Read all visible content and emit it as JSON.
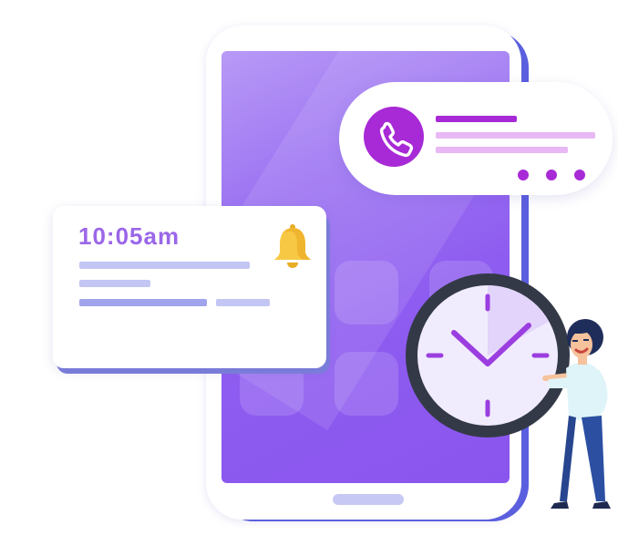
{
  "notification": {
    "time": "10:05am",
    "icon": "bell-icon",
    "accent_color": "#9b67e8"
  },
  "call_card": {
    "icon": "phone-icon",
    "accent_color": "#a72ad6"
  },
  "clock": {
    "icon": "clock-icon"
  },
  "colors": {
    "screen": "#8e5cf0",
    "phone_frame": "#ffffff",
    "clock_rim": "#343947",
    "bell": "#f7c844"
  }
}
